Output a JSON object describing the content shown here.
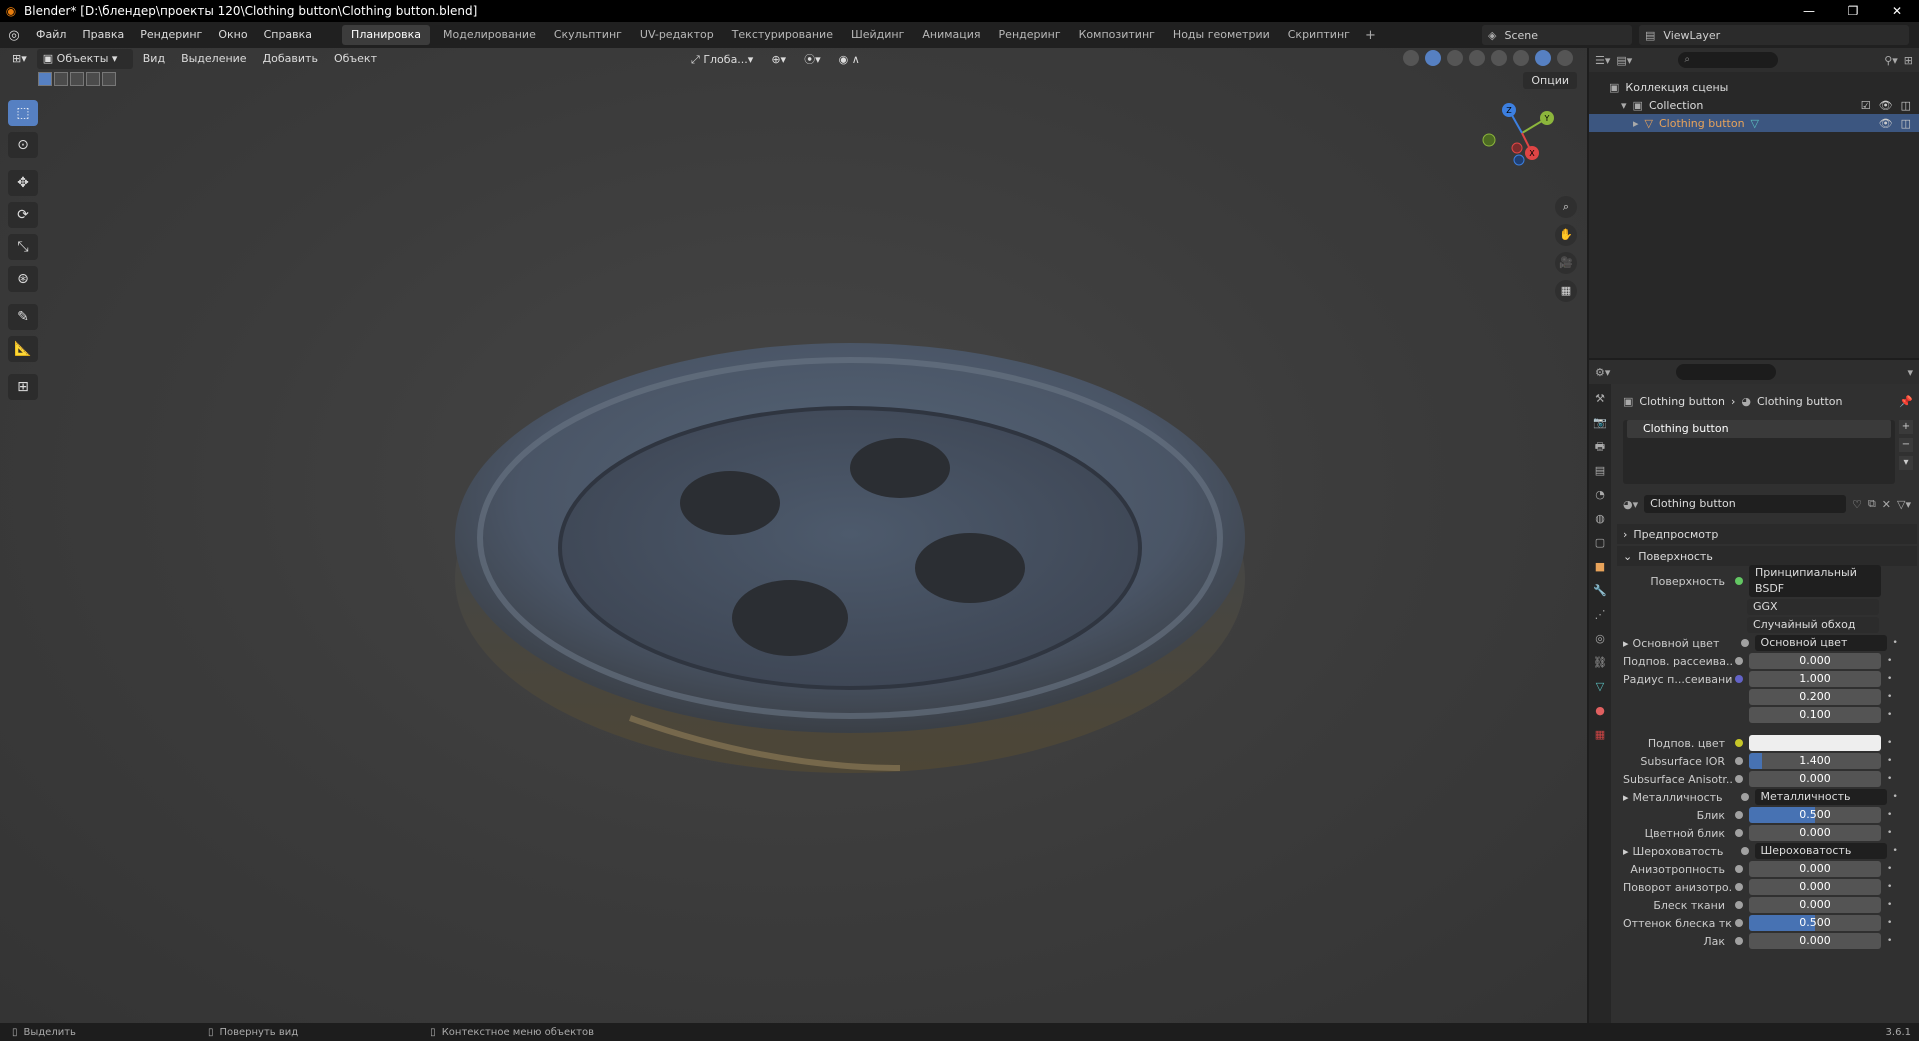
{
  "window": {
    "title": "Blender* [D:\\блендер\\проекты 120\\Clothing button\\Clothing button.blend]",
    "controls": [
      "—",
      "❐",
      "✕"
    ]
  },
  "menu": [
    "Файл",
    "Правка",
    "Рендеринг",
    "Окно",
    "Справка"
  ],
  "workspaces": [
    "Планировка",
    "Моделирование",
    "Скульптинг",
    "UV-редактор",
    "Текстурирование",
    "Шейдинг",
    "Анимация",
    "Рендеринг",
    "Композитинг",
    "Ноды геометрии",
    "Скриптинг"
  ],
  "active_workspace": "Планировка",
  "scene": {
    "label": "Scene",
    "view_layer": "ViewLayer"
  },
  "viewport": {
    "mode": "Объекты",
    "header_menu": [
      "Вид",
      "Выделение",
      "Добавить",
      "Объект"
    ],
    "transform_orientation": "Глоба...",
    "options_label": "Опции",
    "gizmo": {
      "x": "X",
      "y": "Y",
      "z": "Z"
    }
  },
  "outliner": {
    "rows": [
      {
        "label": "Коллекция сцены"
      },
      {
        "label": "Collection"
      },
      {
        "label": "Clothing button"
      }
    ]
  },
  "properties": {
    "breadcrumb": [
      "Clothing button",
      "Clothing button"
    ],
    "material_slot": "Clothing button",
    "material_name": "Clothing button",
    "panel_preview": "Предпросмотр",
    "panel_surface": "Поверхность",
    "surface_label": "Поверхность",
    "surface_value": "Принципиальный BSDF",
    "distribution": "GGX",
    "subsurface_method": "Случайный обход",
    "rows": [
      {
        "label": "Основной цвет",
        "value": "Основной цвет",
        "kind": "link",
        "expand": true
      },
      {
        "label": "Подпов. рассеива...",
        "value": "0.000",
        "kind": "num"
      },
      {
        "label": "Радиус п...сеивания",
        "value": "1.000",
        "kind": "num"
      },
      {
        "label": "",
        "value": "0.200",
        "kind": "num"
      },
      {
        "label": "",
        "value": "0.100",
        "kind": "num"
      },
      {
        "label": "Подпов. цвет",
        "value": "",
        "kind": "color"
      },
      {
        "label": "Subsurface IOR",
        "value": "1.400",
        "kind": "fill",
        "fill": 0.1
      },
      {
        "label": "Subsurface Anisotr...",
        "value": "0.000",
        "kind": "num"
      },
      {
        "label": "Металличность",
        "value": "Металличность",
        "kind": "link",
        "expand": true
      },
      {
        "label": "Блик",
        "value": "0.500",
        "kind": "fill",
        "fill": 0.5
      },
      {
        "label": "Цветной блик",
        "value": "0.000",
        "kind": "num"
      },
      {
        "label": "Шероховатость",
        "value": "Шероховатость",
        "kind": "link",
        "expand": true
      },
      {
        "label": "Анизотропность",
        "value": "0.000",
        "kind": "num"
      },
      {
        "label": "Поворот анизотро...",
        "value": "0.000",
        "kind": "num"
      },
      {
        "label": "Блеск ткани",
        "value": "0.000",
        "kind": "num"
      },
      {
        "label": "Оттенок блеска тк...",
        "value": "0.500",
        "kind": "fill",
        "fill": 0.5
      },
      {
        "label": "Лак",
        "value": "0.000",
        "kind": "num"
      }
    ]
  },
  "status": {
    "items": [
      "Выделить",
      "Повернуть вид",
      "Контекстное меню объектов"
    ],
    "version": "3.6.1"
  },
  "colors": {
    "accent": "#4772b3",
    "selection": "#3c5680",
    "orange": "#e87d0d"
  }
}
